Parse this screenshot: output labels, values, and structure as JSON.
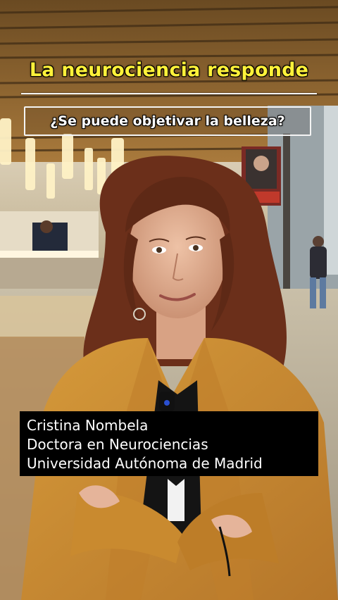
{
  "overlay": {
    "headline": "La neurociencia responde",
    "question": "¿Se puede objetivar la belleza?"
  },
  "caption": {
    "name": "Cristina Nombela",
    "role": "Doctora en Neurociencias",
    "institution": "Universidad Autónoma de Madrid"
  },
  "colors": {
    "headline": "#fff23a",
    "caption_bg": "#000000",
    "jacket": "#c98a2f",
    "hair": "#6b2f1a"
  }
}
